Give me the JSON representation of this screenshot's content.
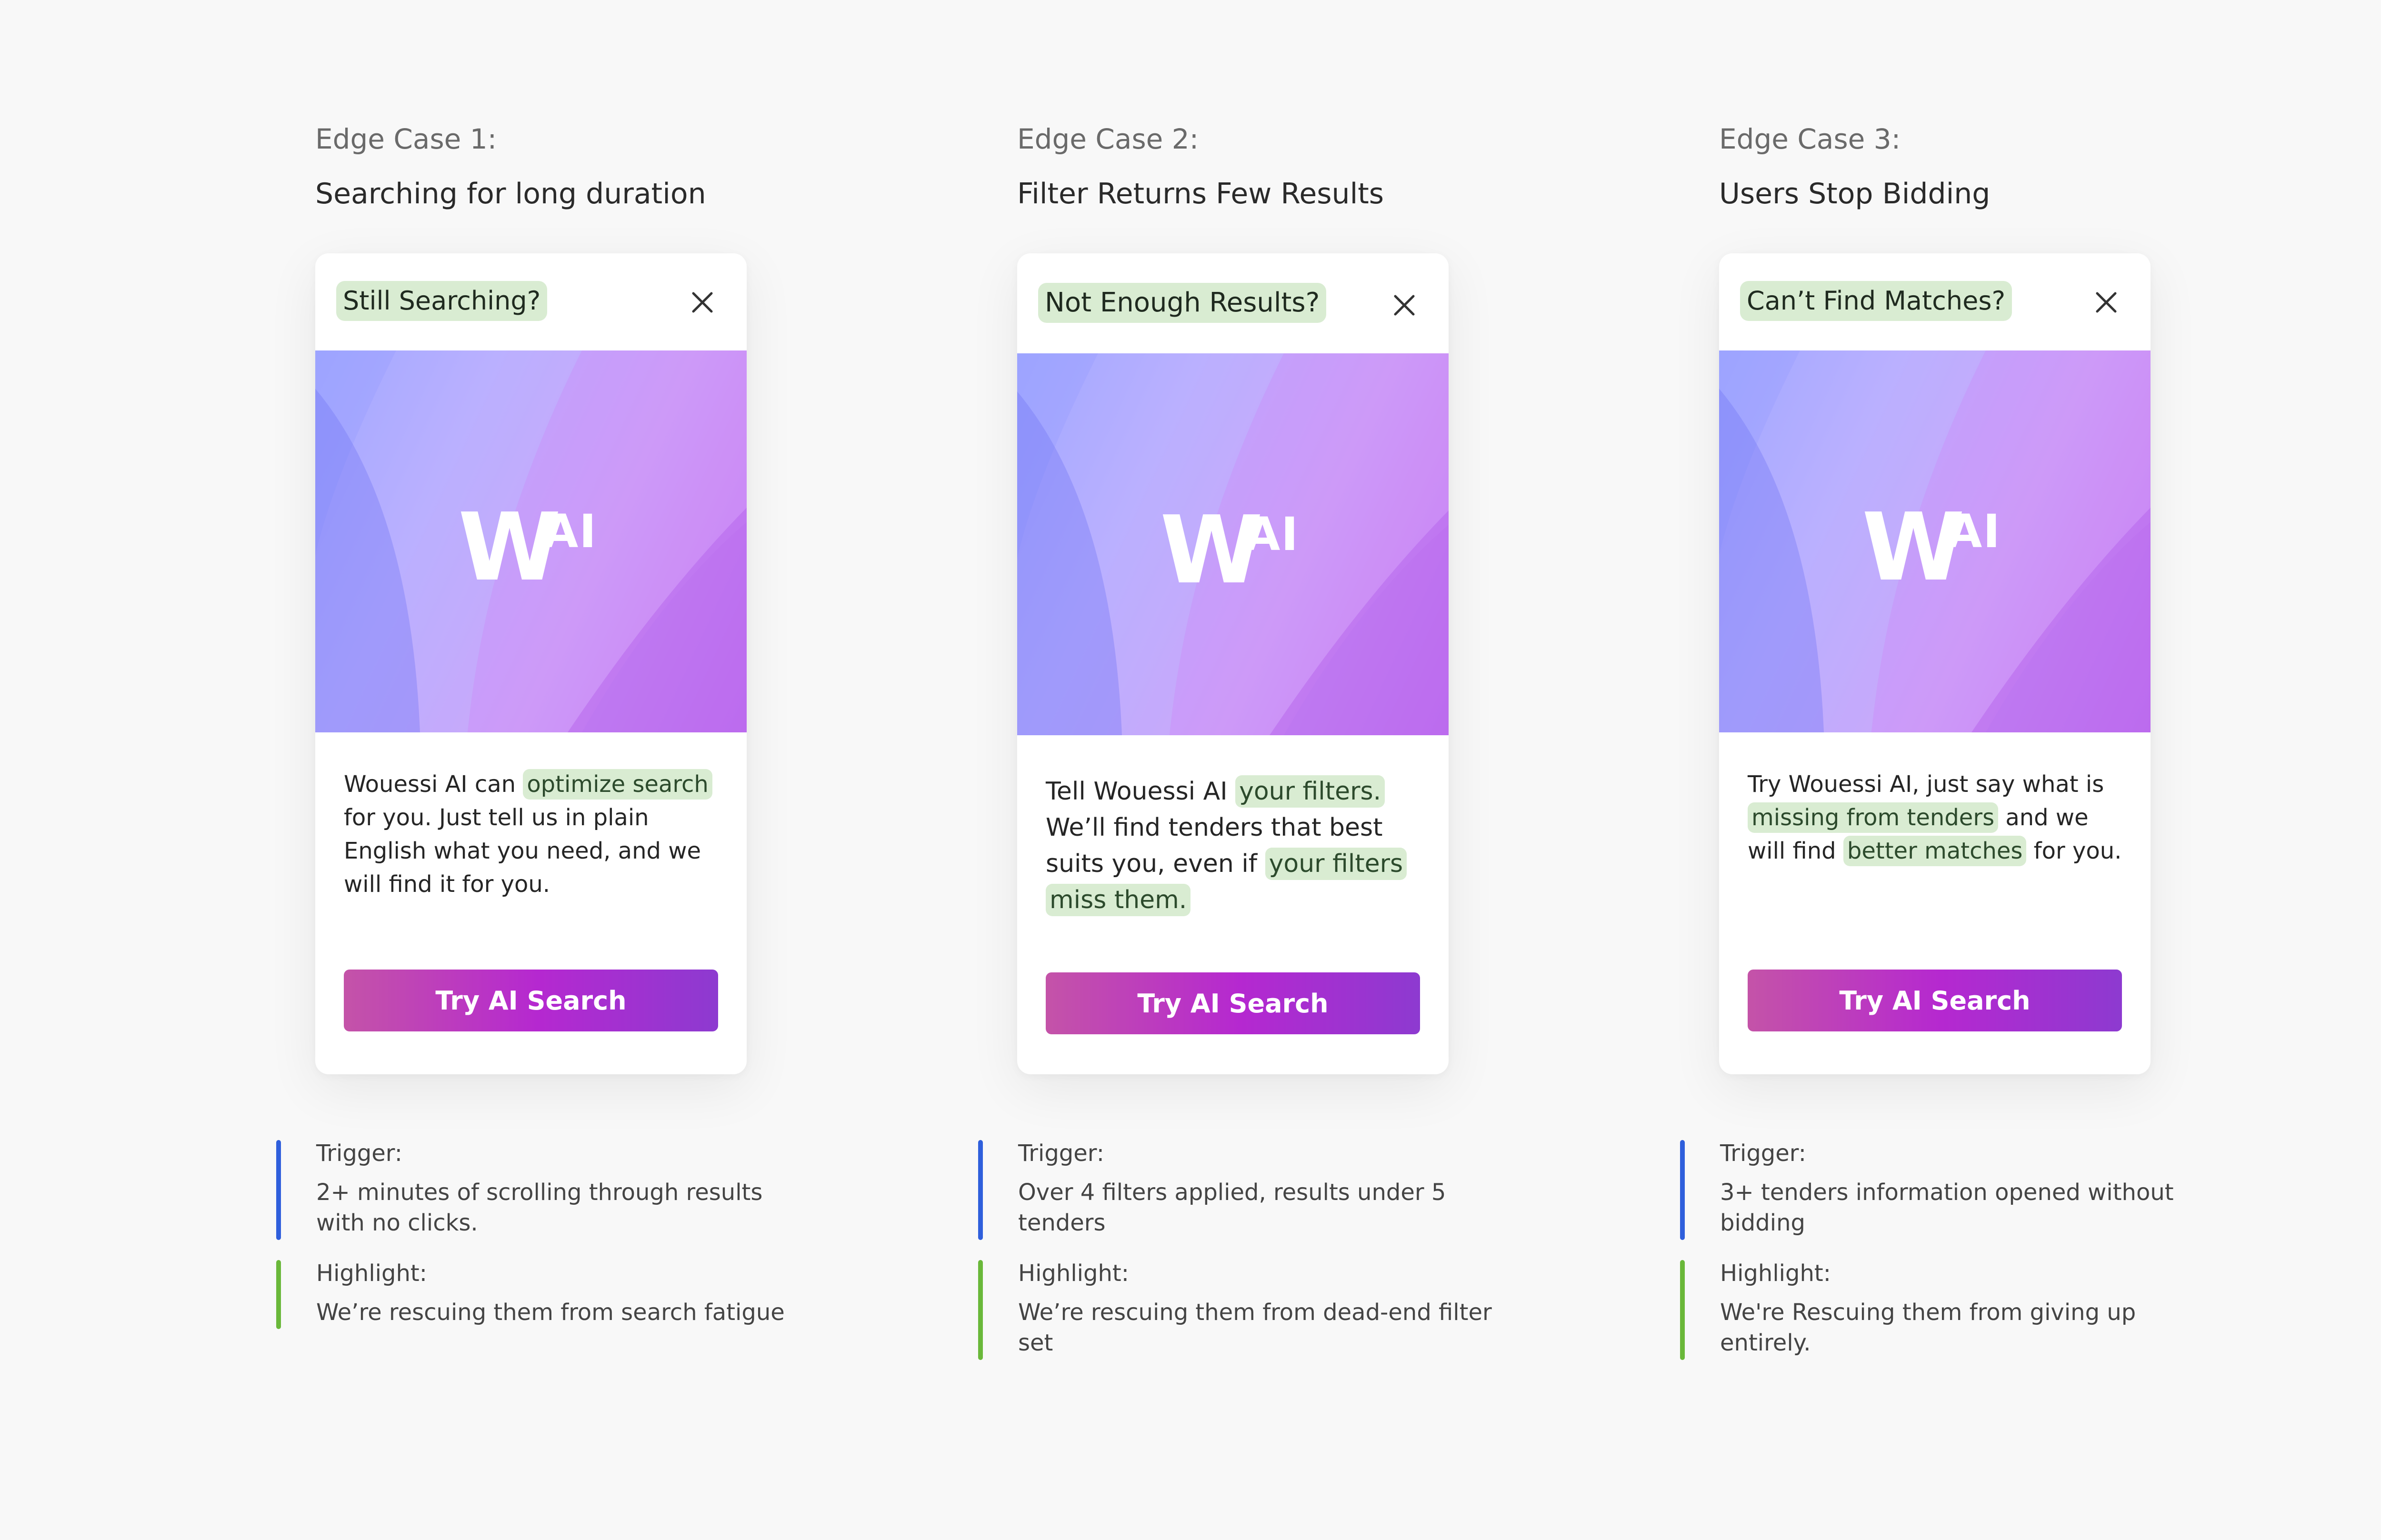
{
  "cases": [
    {
      "label": "Edge Case 1:",
      "title": "Searching for long duration",
      "popup_title": "Still Searching?",
      "body": [
        {
          "text": "Wouessi AI can ",
          "highlight": false
        },
        {
          "text": "optimize search",
          "highlight": true
        },
        {
          "text": " for you. Just tell us in plain English what you need, and we will find it for you.",
          "highlight": false
        }
      ],
      "button": "Try AI Search",
      "trigger_label": "Trigger:",
      "trigger": "2+ minutes of scrolling through results with no clicks.",
      "highlight_label": "Highlight:",
      "highlight": "We’re rescuing them from search fatigue"
    },
    {
      "label": "Edge Case 2:",
      "title": "Filter Returns Few Results",
      "popup_title": "Not Enough Results?",
      "body": [
        {
          "text": "Tell Wouessi AI ",
          "highlight": false
        },
        {
          "text": "your filters.",
          "highlight": true
        },
        {
          "text": " We’ll find tenders that best suits you, even if ",
          "highlight": false
        },
        {
          "text": "your filters miss them.",
          "highlight": true
        }
      ],
      "button": "Try AI Search",
      "trigger_label": "Trigger:",
      "trigger": "Over 4 filters applied, results under 5 tenders",
      "highlight_label": "Highlight:",
      "highlight": "We’re rescuing them from dead-end filter set"
    },
    {
      "label": "Edge Case 3:",
      "title": "Users Stop Bidding",
      "popup_title": "Can’t Find Matches?",
      "body": [
        {
          "text": "Try Wouessi AI, just say what is ",
          "highlight": false
        },
        {
          "text": "missing from tenders",
          "highlight": true
        },
        {
          "text": " and we will find ",
          "highlight": false
        },
        {
          "text": "better matches",
          "highlight": true
        },
        {
          "text": " for you.",
          "highlight": false
        }
      ],
      "button": "Try AI Search",
      "trigger_label": "Trigger:",
      "trigger": "3+ tenders information opened without bidding",
      "highlight_label": "Highlight:",
      "highlight": "We're Rescuing them from giving up entirely."
    }
  ],
  "logo": {
    "main": "W",
    "sup": "AI"
  },
  "icons": {
    "close": "close-icon"
  },
  "colors": {
    "background": "#f8f8f8",
    "highlight_bg": "#d9ecd2",
    "trigger_bar": "#2f5fdc",
    "highlight_bar": "#6ab83a",
    "button_start": "#c453a8",
    "button_mid": "#b528d0",
    "button_end": "#8d3ad0"
  }
}
